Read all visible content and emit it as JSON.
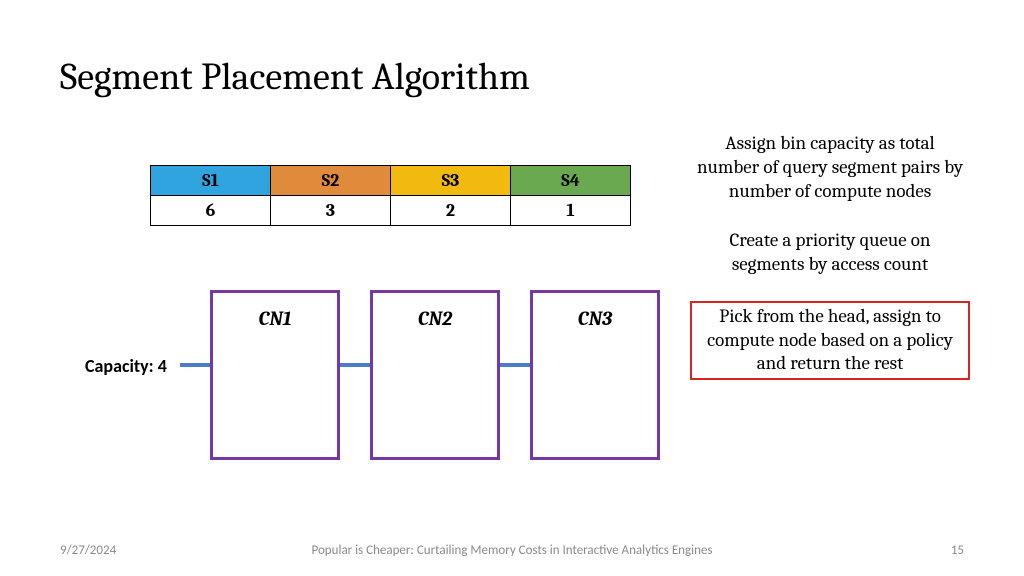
{
  "title": "Segment Placement Algorithm",
  "segments": {
    "headers": [
      "S1",
      "S2",
      "S3",
      "S4"
    ],
    "values": [
      "6",
      "3",
      "2",
      "1"
    ]
  },
  "capacity_label": "Capacity: 4",
  "bins": [
    "CN1",
    "CN2",
    "CN3"
  ],
  "steps": [
    {
      "text": "Assign bin capacity as total number of query segment pairs by number of compute nodes",
      "boxed": false
    },
    {
      "text": "Create a priority queue on segments by access count",
      "boxed": false
    },
    {
      "text": "Pick from the head, assign to compute node based on a policy and return the rest",
      "boxed": true
    }
  ],
  "footer": {
    "date": "9/27/2024",
    "title": "Popular is Cheaper: Curtailing Memory Costs in Interactive Analytics Engines",
    "page": "15"
  },
  "colors": {
    "s1": "#2fa4de",
    "s2": "#e08a3c",
    "s3": "#f2b90f",
    "s4": "#6aa94f",
    "bin_border": "#7537a6",
    "line": "#4a7dc9",
    "highlight_border": "#d22"
  }
}
